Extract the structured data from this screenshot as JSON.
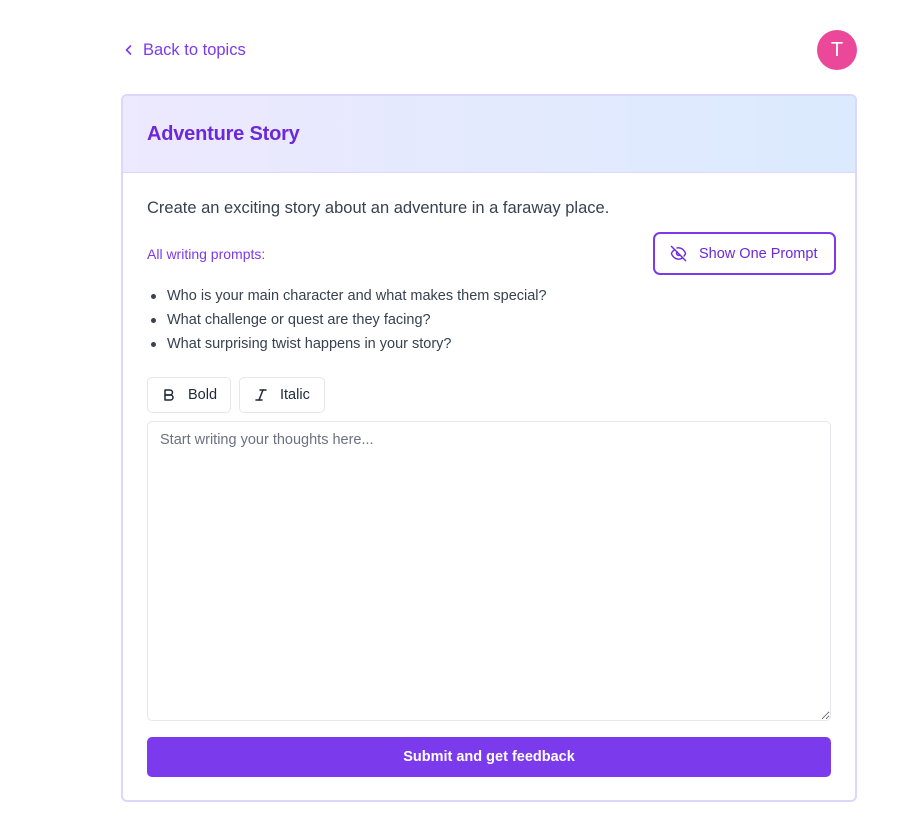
{
  "nav": {
    "back_label": "Back to topics",
    "back_icon": "chevron-left-icon"
  },
  "user": {
    "avatar_initial": "T",
    "avatar_color": "#ec4899"
  },
  "topic": {
    "title": "Adventure Story",
    "description": "Create an exciting story about an adventure in a faraway place."
  },
  "prompts": {
    "label": "All writing prompts:",
    "toggle_label": "Show One Prompt",
    "toggle_icon": "eye-off-icon",
    "items": [
      "Who is your main character and what makes them special?",
      "What challenge or quest are they facing?",
      "What surprising twist happens in your story?"
    ]
  },
  "toolbar": {
    "bold_label": "Bold",
    "bold_icon": "bold-icon",
    "italic_label": "Italic",
    "italic_icon": "italic-icon"
  },
  "editor": {
    "placeholder": "Start writing your thoughts here...",
    "value": ""
  },
  "submit": {
    "label": "Submit and get feedback"
  },
  "colors": {
    "accent": "#7c3aed",
    "title": "#6d28d9",
    "header_gradient_start": "#ede9fe",
    "header_gradient_end": "#dbeafe",
    "card_border": "#ddd6fe"
  }
}
